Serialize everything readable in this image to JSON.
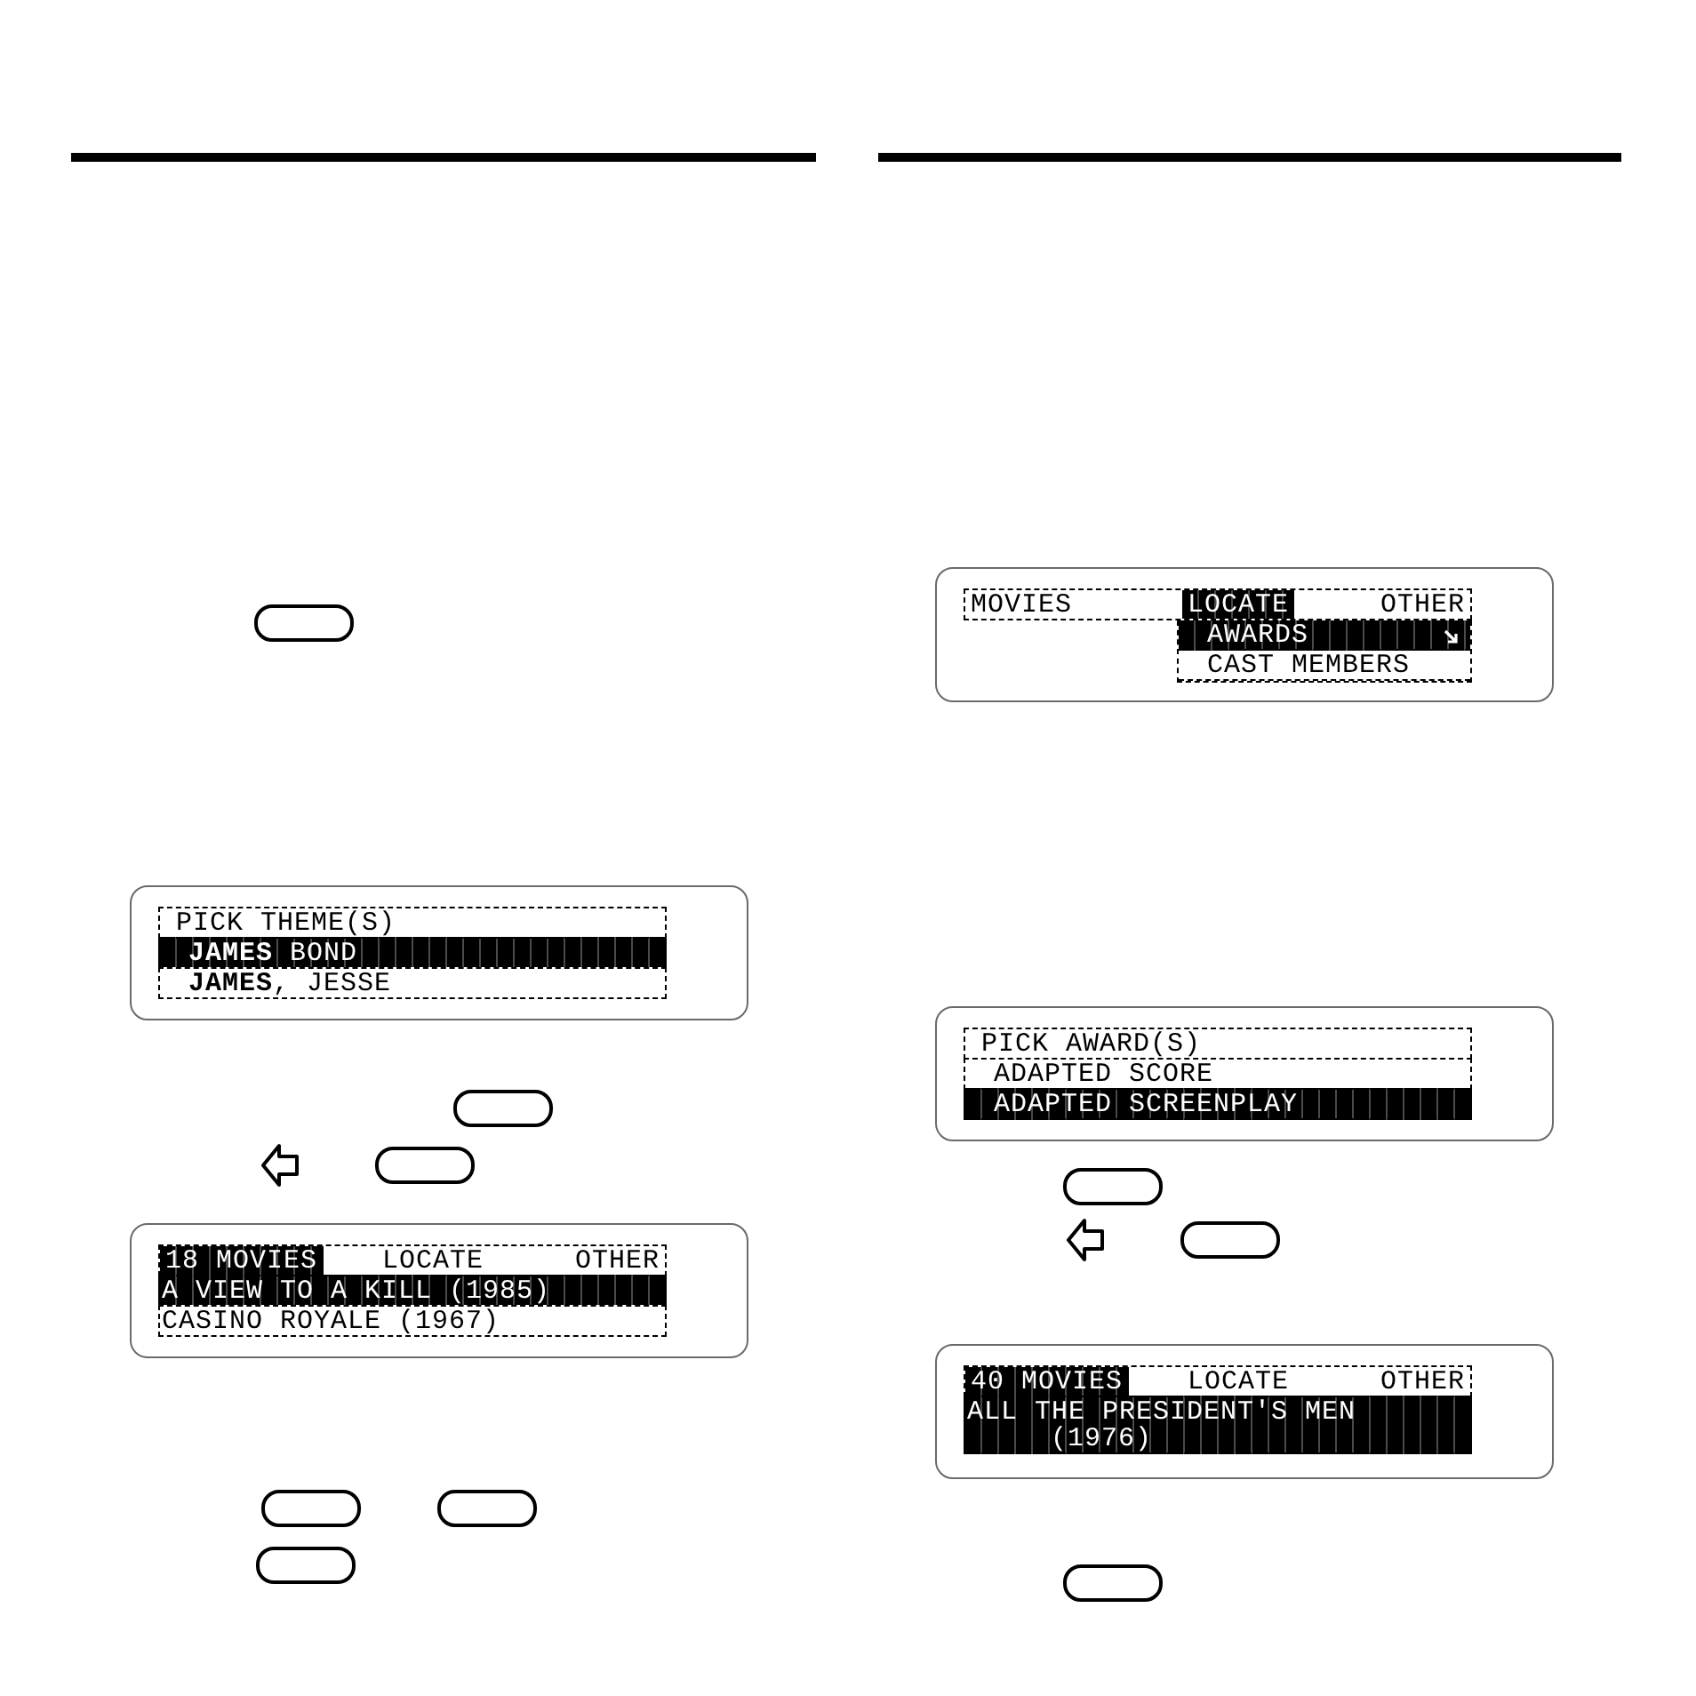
{
  "columns": [
    {
      "blocks": [
        {
          "kind": "keys",
          "items": [
            {
              "kind": "key"
            }
          ]
        },
        {
          "kind": "screen",
          "lines": [
            {
              "kind": "heading",
              "text": "PICK THEME(S)",
              "selected": false
            },
            {
              "kind": "option",
              "text": "**JAMES** BOND",
              "selected": true
            },
            {
              "kind": "option",
              "text": "**JAMES**, JESSE",
              "selected": false
            }
          ]
        },
        {
          "kind": "keys",
          "items": [
            {
              "kind": "key"
            }
          ]
        },
        {
          "kind": "keys",
          "items": [
            {
              "kind": "arrow"
            },
            {
              "kind": "key"
            }
          ]
        },
        {
          "kind": "screen",
          "lines": [
            {
              "kind": "tabs",
              "tabs": [
                {
                  "label": "18 MOVIES",
                  "selected": true
                },
                {
                  "label": "LOCATE",
                  "selected": false
                },
                {
                  "label": "OTHER",
                  "selected": false
                }
              ]
            },
            {
              "kind": "entry",
              "text": "A VIEW TO A KILL (1985)",
              "selected": true
            },
            {
              "kind": "entry",
              "text": "CASINO ROYALE (1967)",
              "selected": false
            }
          ]
        },
        {
          "kind": "keys",
          "items": [
            {
              "kind": "key"
            },
            {
              "kind": "key"
            }
          ]
        },
        {
          "kind": "keys",
          "items": [
            {
              "kind": "key"
            }
          ]
        }
      ]
    },
    {
      "blocks": [
        {
          "kind": "screen",
          "lines": [
            {
              "kind": "tabs",
              "tabs": [
                {
                  "label": "MOVIES",
                  "selected": false
                },
                {
                  "label": "LOCATE",
                  "selected": true
                },
                {
                  "label": "OTHER",
                  "selected": false
                }
              ]
            },
            {
              "kind": "menu",
              "items": [
                {
                  "label": "AWARDS",
                  "selected": true,
                  "submenu": true
                },
                {
                  "label": "CAST MEMBERS",
                  "selected": false,
                  "submenu": false
                }
              ]
            }
          ]
        },
        {
          "kind": "screen",
          "lines": [
            {
              "kind": "heading",
              "text": "PICK AWARD(S)",
              "selected": false
            },
            {
              "kind": "option",
              "text": "ADAPTED SCORE",
              "selected": false
            },
            {
              "kind": "option",
              "text": "ADAPTED SCREENPLAY",
              "selected": true
            }
          ]
        },
        {
          "kind": "keys",
          "items": [
            {
              "kind": "key"
            }
          ]
        },
        {
          "kind": "keys",
          "items": [
            {
              "kind": "arrow"
            },
            {
              "kind": "key"
            }
          ]
        },
        {
          "kind": "screen",
          "lines": [
            {
              "kind": "tabs",
              "tabs": [
                {
                  "label": "40 MOVIES",
                  "selected": true
                },
                {
                  "label": "LOCATE",
                  "selected": false
                },
                {
                  "label": "OTHER",
                  "selected": false
                }
              ]
            },
            {
              "kind": "entry",
              "text": "ALL THE PRESIDENT'S MEN",
              "continuation": "(1976)",
              "selected": true
            }
          ]
        },
        {
          "kind": "keys",
          "items": [
            {
              "kind": "key"
            }
          ]
        }
      ]
    }
  ]
}
